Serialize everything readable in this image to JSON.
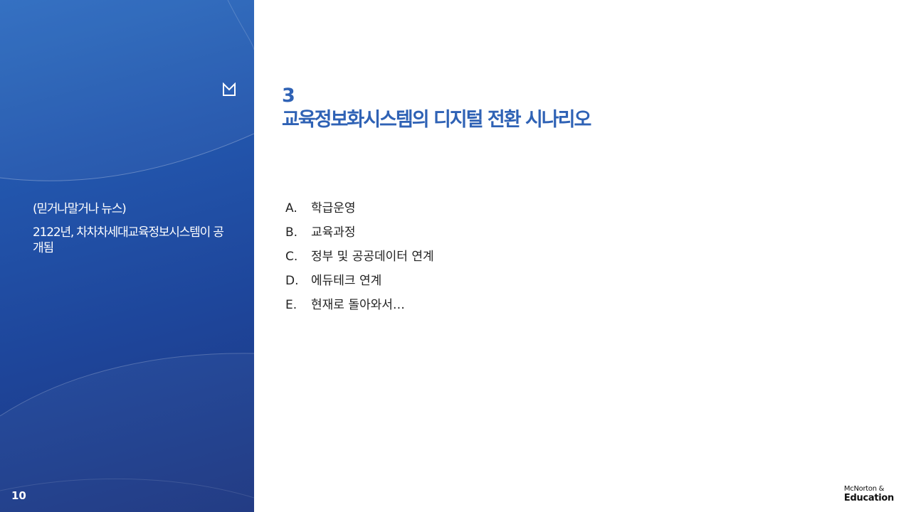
{
  "sidebar": {
    "kicker": "(믿거나말거나 뉴스)",
    "headline": "2122년, 차차차세대교육정보시스템이 공개됨",
    "page_number": "10",
    "logo_icon": "m-monogram-logo-icon"
  },
  "main": {
    "section_number": "3",
    "section_title": "교육정보화시스템의 디지털 전환 시나리오",
    "items": [
      {
        "letter": "A.",
        "label": "학급운영"
      },
      {
        "letter": "B.",
        "label": "교육과정"
      },
      {
        "letter": "C.",
        "label": "정부 및 공공데이터 연계"
      },
      {
        "letter": "D.",
        "label": "에듀테크 연계"
      },
      {
        "letter": "E.",
        "label": "현재로 돌아와서…"
      }
    ]
  },
  "brand": {
    "line1": "McNorton &",
    "line2": "Education"
  },
  "colors": {
    "accent": "#2f62b5",
    "panel_top": "#2d6cc0",
    "panel_bottom": "#1b3580"
  }
}
